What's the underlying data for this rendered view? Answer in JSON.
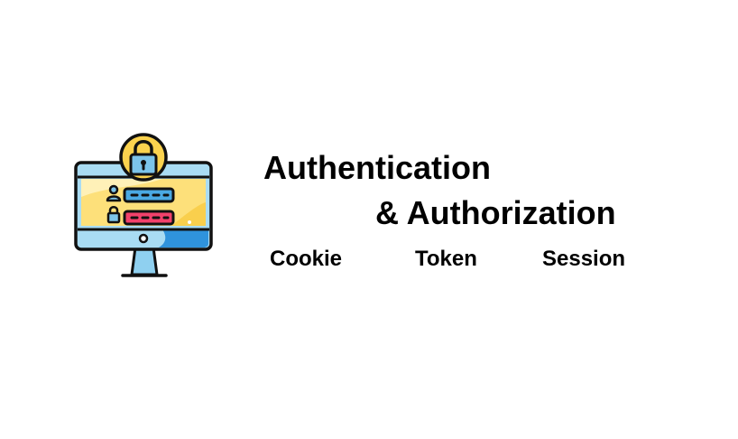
{
  "illustration": {
    "name": "computer-lock-login-icon",
    "colors": {
      "outline": "#111111",
      "screen_blue": "#a9dcf3",
      "screen_yellow": "#fde07a",
      "lock_badge": "#fbd24e",
      "lock_body": "#7cc4ea",
      "username_field": "#4aa9e3",
      "password_field": "#f2416b",
      "stand": "#8fd0f0",
      "base_strip": "#2f93dc"
    }
  },
  "heading": {
    "line1": "Authentication",
    "line2": "& Authorization"
  },
  "keywords": [
    "Cookie",
    "Token",
    "Session"
  ]
}
